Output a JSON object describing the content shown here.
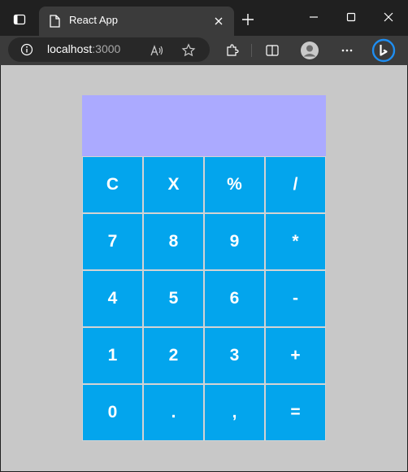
{
  "browser": {
    "tab": {
      "title": "React App"
    },
    "address": {
      "host": "localhost",
      "port": ":3000"
    }
  },
  "calculator": {
    "display": "",
    "keys": [
      [
        "C",
        "X",
        "%",
        "/"
      ],
      [
        "7",
        "8",
        "9",
        "*"
      ],
      [
        "4",
        "5",
        "6",
        "-"
      ],
      [
        "1",
        "2",
        "3",
        "+"
      ],
      [
        "0",
        ".",
        ",",
        "="
      ]
    ]
  },
  "colors": {
    "page_background": "#c8c8c8",
    "display_background": "#abaaff",
    "key_background": "#03a5ed",
    "key_text": "#ffffff"
  }
}
